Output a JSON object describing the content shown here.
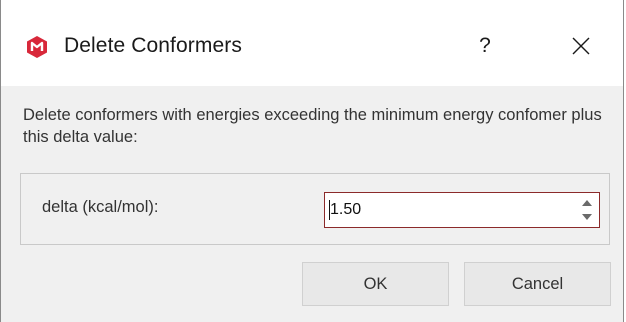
{
  "window": {
    "title": "Delete Conformers",
    "help_label": "?",
    "app_icon": "app-logo-icon",
    "close_icon": "close-icon"
  },
  "dialog": {
    "description": "Delete conformers with energies exceeding the minimum energy confomer plus this delta value:",
    "delta_label": "delta (kcal/mol):",
    "delta_value": "1.50"
  },
  "buttons": {
    "ok_label": "OK",
    "cancel_label": "Cancel"
  },
  "colors": {
    "accent_red": "#d8283a",
    "focus_border": "#8b2a2a",
    "content_bg": "#f0f0f0"
  }
}
